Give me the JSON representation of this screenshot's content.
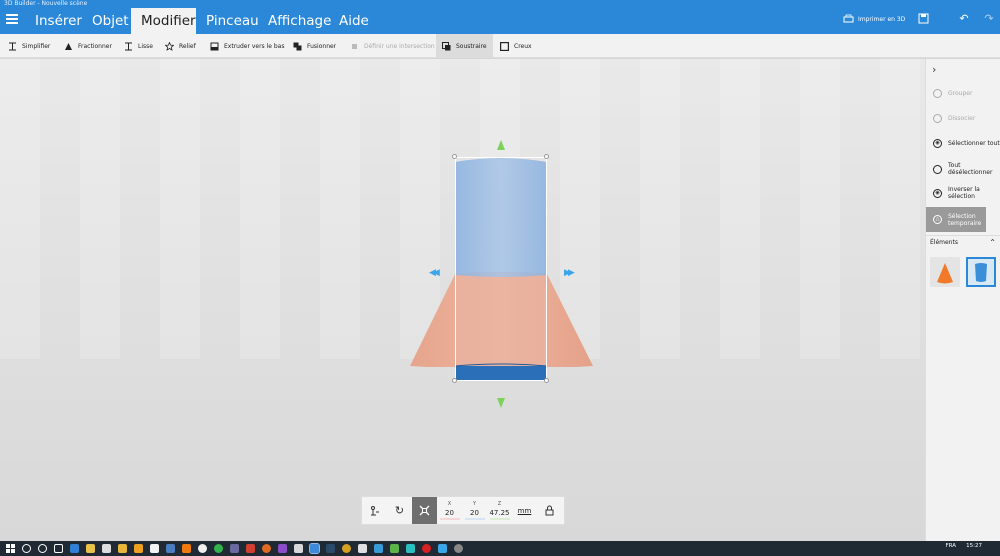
{
  "window": {
    "title": "3D Builder - Nouvelle scène"
  },
  "tabs": [
    {
      "label": "Insérer"
    },
    {
      "label": "Objet"
    },
    {
      "label": "Modifier",
      "active": true
    },
    {
      "label": "Pinceau"
    },
    {
      "label": "Affichage"
    },
    {
      "label": "Aide"
    }
  ],
  "header": {
    "print_label": "Imprimer en 3D"
  },
  "toolbar": {
    "simplifier": "Simplifier",
    "fractionner": "Fractionner",
    "lisse": "Lisse",
    "relief": "Relief",
    "extruder": "Extruder vers le bas",
    "fusionner": "Fusionner",
    "intersection": "Définir une intersection",
    "soustraire": "Soustraire",
    "creux": "Creux"
  },
  "panel": {
    "grouper": "Grouper",
    "dissocier": "Dissocier",
    "select_all": "Sélectionner tout",
    "deselect_all_1": "Tout",
    "deselect_all_2": "désélectionner",
    "invert_1": "Inverser la",
    "invert_2": "sélection",
    "temp_1": "Sélection",
    "temp_2": "temporaire",
    "elements": "Éléments"
  },
  "transform": {
    "x_label": "X",
    "x_value": "20",
    "y_label": "Y",
    "y_value": "20",
    "z_label": "Z",
    "z_value": "47.25",
    "unit": "mm"
  },
  "taskbar": {
    "lang": "FRA",
    "time": "15:27"
  },
  "colors": {
    "accent": "#2b88d8",
    "cone": "#e8a488",
    "cylinder": "#8fb3de",
    "arrow_green": "#7dd35a",
    "arrow_blue": "#3aa6e8"
  }
}
